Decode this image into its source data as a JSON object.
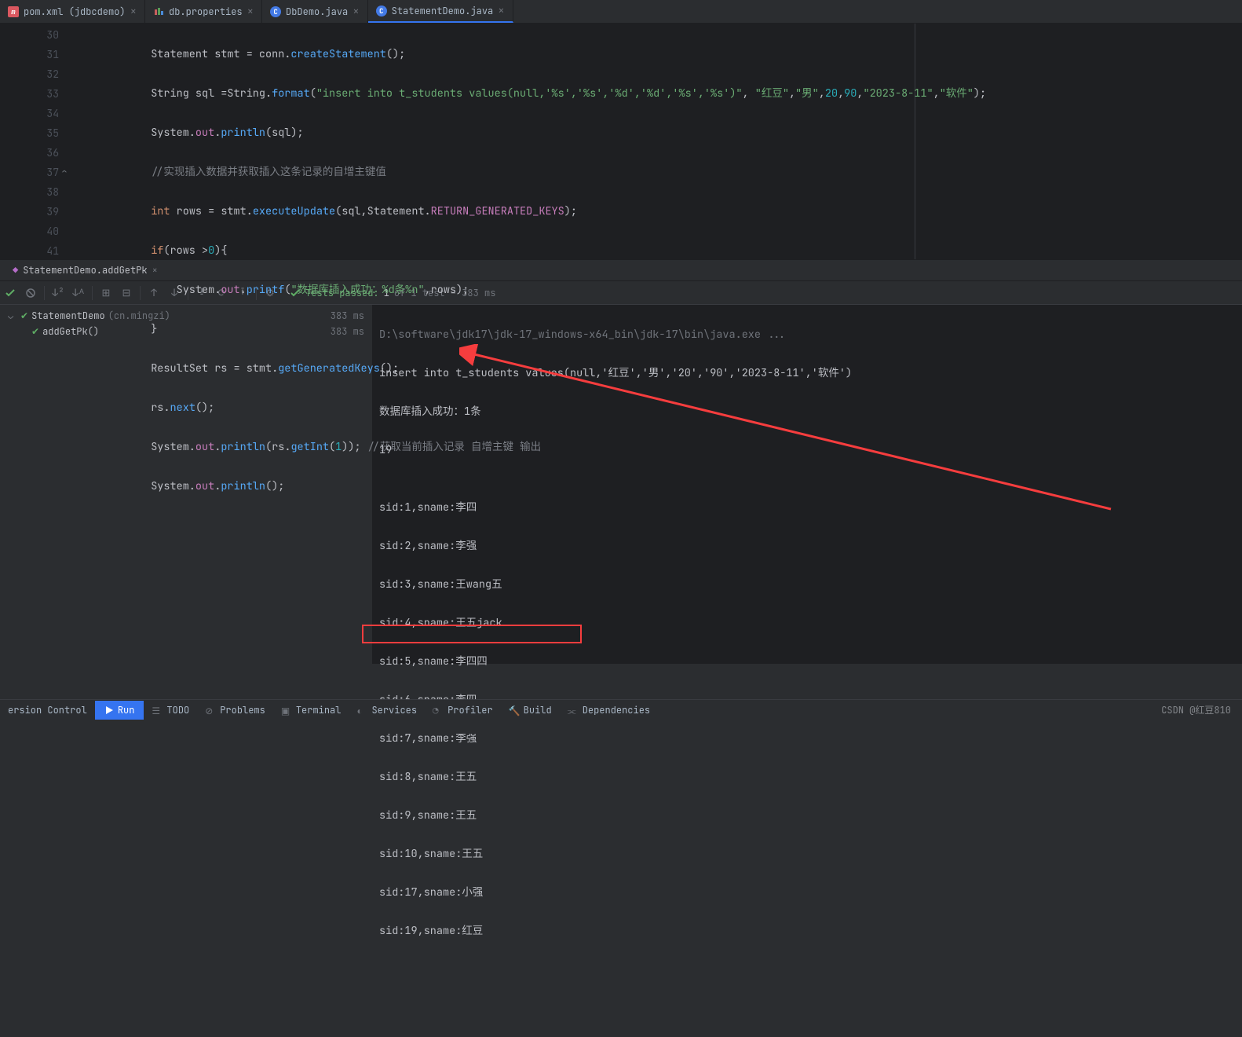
{
  "tabs": [
    {
      "label": "pom.xml (jdbcdemo)",
      "icon": "m",
      "active": false
    },
    {
      "label": "db.properties",
      "icon": "p",
      "active": false
    },
    {
      "label": "DbDemo.java",
      "icon": "j",
      "active": false
    },
    {
      "label": "StatementDemo.java",
      "icon": "j",
      "active": true
    }
  ],
  "gutter": [
    "30",
    "31",
    "32",
    "33",
    "34",
    "35",
    "36",
    "37",
    "38",
    "39",
    "40",
    "41"
  ],
  "code": {
    "l30": {
      "t1": "Statement stmt = conn.",
      "m": "createStatement",
      "t2": "();"
    },
    "l31": {
      "t1": "String sql =String.",
      "m": "format",
      "s1": "(",
      "str": "\"insert into t_students values(null,'%s','%s','%d','%d','%s','%s')\"",
      "c": ", ",
      "a1": "\"红豆\"",
      "a2": "\"男\"",
      "n1": "20",
      "n2": "90",
      "a3": "\"2023-8-11\"",
      "a4": "\"软件\"",
      "e": ");"
    },
    "l32": {
      "p": "System.",
      "o": "out",
      "d": ".",
      "m": "println",
      "a": "(sql);"
    },
    "l33": "//实现插入数据并获取插入这条记录的自增主键值",
    "l34": {
      "k": "int",
      "t": " rows = stmt.",
      "m": "executeUpdate",
      "a": "(sql,Statement.",
      "c": "RETURN_GENERATED_KEYS",
      "e": ");"
    },
    "l35": {
      "k": "if",
      "t": "(rows >",
      "n": "0",
      "b": "){"
    },
    "l36": {
      "p": "    System.",
      "o": "out",
      "d": ".",
      "m": "printf",
      "s": "(",
      "str": "\"数据库插入成功：%d条%n\"",
      "r": ",rows);"
    },
    "l37": "}",
    "l38": {
      "t": "ResultSet rs = stmt.",
      "m": "getGeneratedKeys",
      "e": "();"
    },
    "l39": {
      "t": "rs.",
      "m": "next",
      "e": "();"
    },
    "l40": {
      "p": "System.",
      "o": "out",
      "d": ".",
      "m": "println",
      "a": "(rs.",
      "m2": "getInt",
      "n": "(",
      "num": "1",
      "r": ")); ",
      "c": "//获取当前插入记录 自增主键 输出"
    },
    "l41": {
      "p": "System.",
      "o": "out",
      "d": ".",
      "m": "println",
      "a": "();"
    }
  },
  "run_tab": "StatementDemo.addGetPk",
  "tests": {
    "label": "Tests passed:",
    "passed": "1",
    "of": "of 1 test – 383 ms"
  },
  "tree": {
    "root": {
      "name": "StatementDemo",
      "pkg": "(cn.mingzi)",
      "time": "383 ms"
    },
    "child": {
      "name": "addGetPk()",
      "time": "383 ms"
    }
  },
  "console": {
    "l0": "D:\\software\\jdk17\\jdk-17_windows-x64_bin\\jdk-17\\bin\\java.exe ...",
    "l1": "insert into t_students values(null,'红豆','男','20','90','2023-8-11','软件')",
    "l2": "数据库插入成功：1条",
    "l3": "19",
    "l4": "",
    "l5": "sid:1,sname:李四",
    "l6": "sid:2,sname:李强",
    "l7": "sid:3,sname:王wang五",
    "l8": "sid:4,sname:王五jack",
    "l9": "sid:5,sname:李四四",
    "l10": "sid:6,sname:李四",
    "l11": "sid:7,sname:李强",
    "l12": "sid:8,sname:王五",
    "l13": "sid:9,sname:王五",
    "l14": "sid:10,sname:王五",
    "l15": "sid:17,sname:小强",
    "l16": "sid:19,sname:红豆"
  },
  "bottom": {
    "vc": "ersion Control",
    "run": "Run",
    "todo": "TODO",
    "problems": "Problems",
    "terminal": "Terminal",
    "services": "Services",
    "profiler": "Profiler",
    "build": "Build",
    "deps": "Dependencies"
  },
  "watermark": "CSDN @红豆810"
}
